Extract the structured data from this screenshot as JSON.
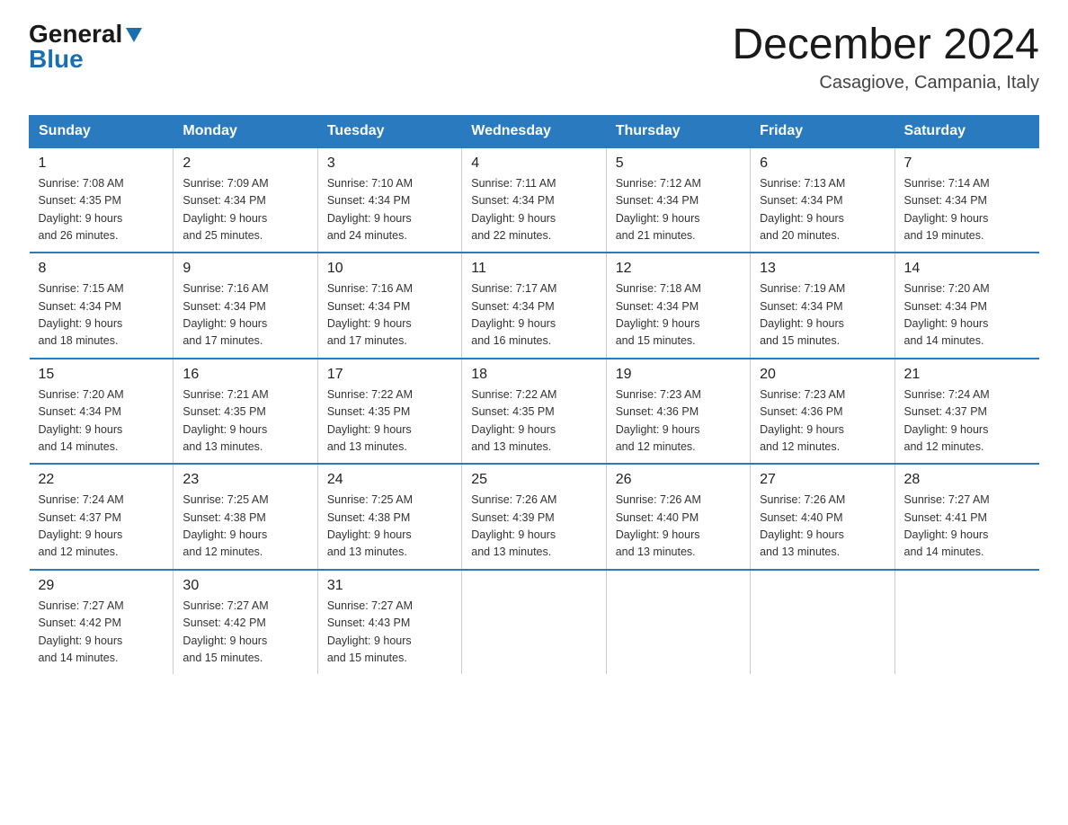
{
  "logo": {
    "general": "General",
    "blue": "Blue"
  },
  "title": {
    "month": "December 2024",
    "location": "Casagiove, Campania, Italy"
  },
  "headers": [
    "Sunday",
    "Monday",
    "Tuesday",
    "Wednesday",
    "Thursday",
    "Friday",
    "Saturday"
  ],
  "weeks": [
    [
      {
        "day": "1",
        "sunrise": "7:08 AM",
        "sunset": "4:35 PM",
        "daylight": "9 hours and 26 minutes."
      },
      {
        "day": "2",
        "sunrise": "7:09 AM",
        "sunset": "4:34 PM",
        "daylight": "9 hours and 25 minutes."
      },
      {
        "day": "3",
        "sunrise": "7:10 AM",
        "sunset": "4:34 PM",
        "daylight": "9 hours and 24 minutes."
      },
      {
        "day": "4",
        "sunrise": "7:11 AM",
        "sunset": "4:34 PM",
        "daylight": "9 hours and 22 minutes."
      },
      {
        "day": "5",
        "sunrise": "7:12 AM",
        "sunset": "4:34 PM",
        "daylight": "9 hours and 21 minutes."
      },
      {
        "day": "6",
        "sunrise": "7:13 AM",
        "sunset": "4:34 PM",
        "daylight": "9 hours and 20 minutes."
      },
      {
        "day": "7",
        "sunrise": "7:14 AM",
        "sunset": "4:34 PM",
        "daylight": "9 hours and 19 minutes."
      }
    ],
    [
      {
        "day": "8",
        "sunrise": "7:15 AM",
        "sunset": "4:34 PM",
        "daylight": "9 hours and 18 minutes."
      },
      {
        "day": "9",
        "sunrise": "7:16 AM",
        "sunset": "4:34 PM",
        "daylight": "9 hours and 17 minutes."
      },
      {
        "day": "10",
        "sunrise": "7:16 AM",
        "sunset": "4:34 PM",
        "daylight": "9 hours and 17 minutes."
      },
      {
        "day": "11",
        "sunrise": "7:17 AM",
        "sunset": "4:34 PM",
        "daylight": "9 hours and 16 minutes."
      },
      {
        "day": "12",
        "sunrise": "7:18 AM",
        "sunset": "4:34 PM",
        "daylight": "9 hours and 15 minutes."
      },
      {
        "day": "13",
        "sunrise": "7:19 AM",
        "sunset": "4:34 PM",
        "daylight": "9 hours and 15 minutes."
      },
      {
        "day": "14",
        "sunrise": "7:20 AM",
        "sunset": "4:34 PM",
        "daylight": "9 hours and 14 minutes."
      }
    ],
    [
      {
        "day": "15",
        "sunrise": "7:20 AM",
        "sunset": "4:34 PM",
        "daylight": "9 hours and 14 minutes."
      },
      {
        "day": "16",
        "sunrise": "7:21 AM",
        "sunset": "4:35 PM",
        "daylight": "9 hours and 13 minutes."
      },
      {
        "day": "17",
        "sunrise": "7:22 AM",
        "sunset": "4:35 PM",
        "daylight": "9 hours and 13 minutes."
      },
      {
        "day": "18",
        "sunrise": "7:22 AM",
        "sunset": "4:35 PM",
        "daylight": "9 hours and 13 minutes."
      },
      {
        "day": "19",
        "sunrise": "7:23 AM",
        "sunset": "4:36 PM",
        "daylight": "9 hours and 12 minutes."
      },
      {
        "day": "20",
        "sunrise": "7:23 AM",
        "sunset": "4:36 PM",
        "daylight": "9 hours and 12 minutes."
      },
      {
        "day": "21",
        "sunrise": "7:24 AM",
        "sunset": "4:37 PM",
        "daylight": "9 hours and 12 minutes."
      }
    ],
    [
      {
        "day": "22",
        "sunrise": "7:24 AM",
        "sunset": "4:37 PM",
        "daylight": "9 hours and 12 minutes."
      },
      {
        "day": "23",
        "sunrise": "7:25 AM",
        "sunset": "4:38 PM",
        "daylight": "9 hours and 12 minutes."
      },
      {
        "day": "24",
        "sunrise": "7:25 AM",
        "sunset": "4:38 PM",
        "daylight": "9 hours and 13 minutes."
      },
      {
        "day": "25",
        "sunrise": "7:26 AM",
        "sunset": "4:39 PM",
        "daylight": "9 hours and 13 minutes."
      },
      {
        "day": "26",
        "sunrise": "7:26 AM",
        "sunset": "4:40 PM",
        "daylight": "9 hours and 13 minutes."
      },
      {
        "day": "27",
        "sunrise": "7:26 AM",
        "sunset": "4:40 PM",
        "daylight": "9 hours and 13 minutes."
      },
      {
        "day": "28",
        "sunrise": "7:27 AM",
        "sunset": "4:41 PM",
        "daylight": "9 hours and 14 minutes."
      }
    ],
    [
      {
        "day": "29",
        "sunrise": "7:27 AM",
        "sunset": "4:42 PM",
        "daylight": "9 hours and 14 minutes."
      },
      {
        "day": "30",
        "sunrise": "7:27 AM",
        "sunset": "4:42 PM",
        "daylight": "9 hours and 15 minutes."
      },
      {
        "day": "31",
        "sunrise": "7:27 AM",
        "sunset": "4:43 PM",
        "daylight": "9 hours and 15 minutes."
      },
      null,
      null,
      null,
      null
    ]
  ],
  "labels": {
    "sunrise": "Sunrise:",
    "sunset": "Sunset:",
    "daylight": "Daylight:"
  }
}
